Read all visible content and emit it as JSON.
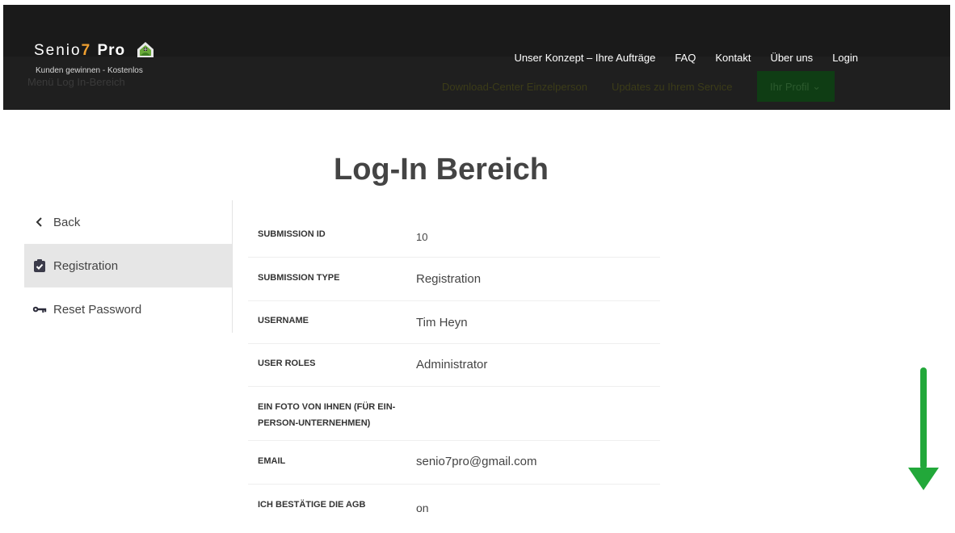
{
  "header": {
    "logo": {
      "name_part1": "Senio",
      "name_seven": "7",
      "name_pro": "Pro",
      "tagline": "Kunden gewinnen - Kostenlos"
    },
    "nav": [
      {
        "label": "Unser Konzept – Ihre Aufträge"
      },
      {
        "label": "FAQ"
      },
      {
        "label": "Kontakt"
      },
      {
        "label": "Über uns"
      },
      {
        "label": "Login"
      }
    ],
    "ghost_menu_label": "Menü Log In-Bereich",
    "ghost_subnav": {
      "link1": "Download-Center Einzelperson",
      "link2": "Updates zu Ihrem Service",
      "button": "Ihr Profil"
    }
  },
  "page": {
    "title": "Log-In Bereich"
  },
  "sidebar": {
    "items": [
      {
        "label": "Back",
        "icon": "chevron-left-icon"
      },
      {
        "label": "Registration",
        "icon": "clipboard-check-icon",
        "active": true
      },
      {
        "label": "Reset Password",
        "icon": "key-icon"
      }
    ]
  },
  "details": {
    "rows": [
      {
        "label": "SUBMISSION ID",
        "value": "10"
      },
      {
        "label": "SUBMISSION TYPE",
        "value": "Registration"
      },
      {
        "label": "USERNAME",
        "value": "Tim Heyn"
      },
      {
        "label": "USER ROLES",
        "value": "Administrator"
      },
      {
        "label": "EIN FOTO VON IHNEN (FÜR EIN-PERSON-UNTERNEHMEN)",
        "value": ""
      },
      {
        "label": "EMAIL",
        "value": "senio7pro@gmail.com"
      },
      {
        "label": "ICH BESTÄTIGE DIE AGB",
        "value": "on"
      }
    ]
  },
  "colors": {
    "header_bg": "#1a1a1a",
    "accent_orange": "#f0a030",
    "arrow_green": "#22a83a"
  }
}
